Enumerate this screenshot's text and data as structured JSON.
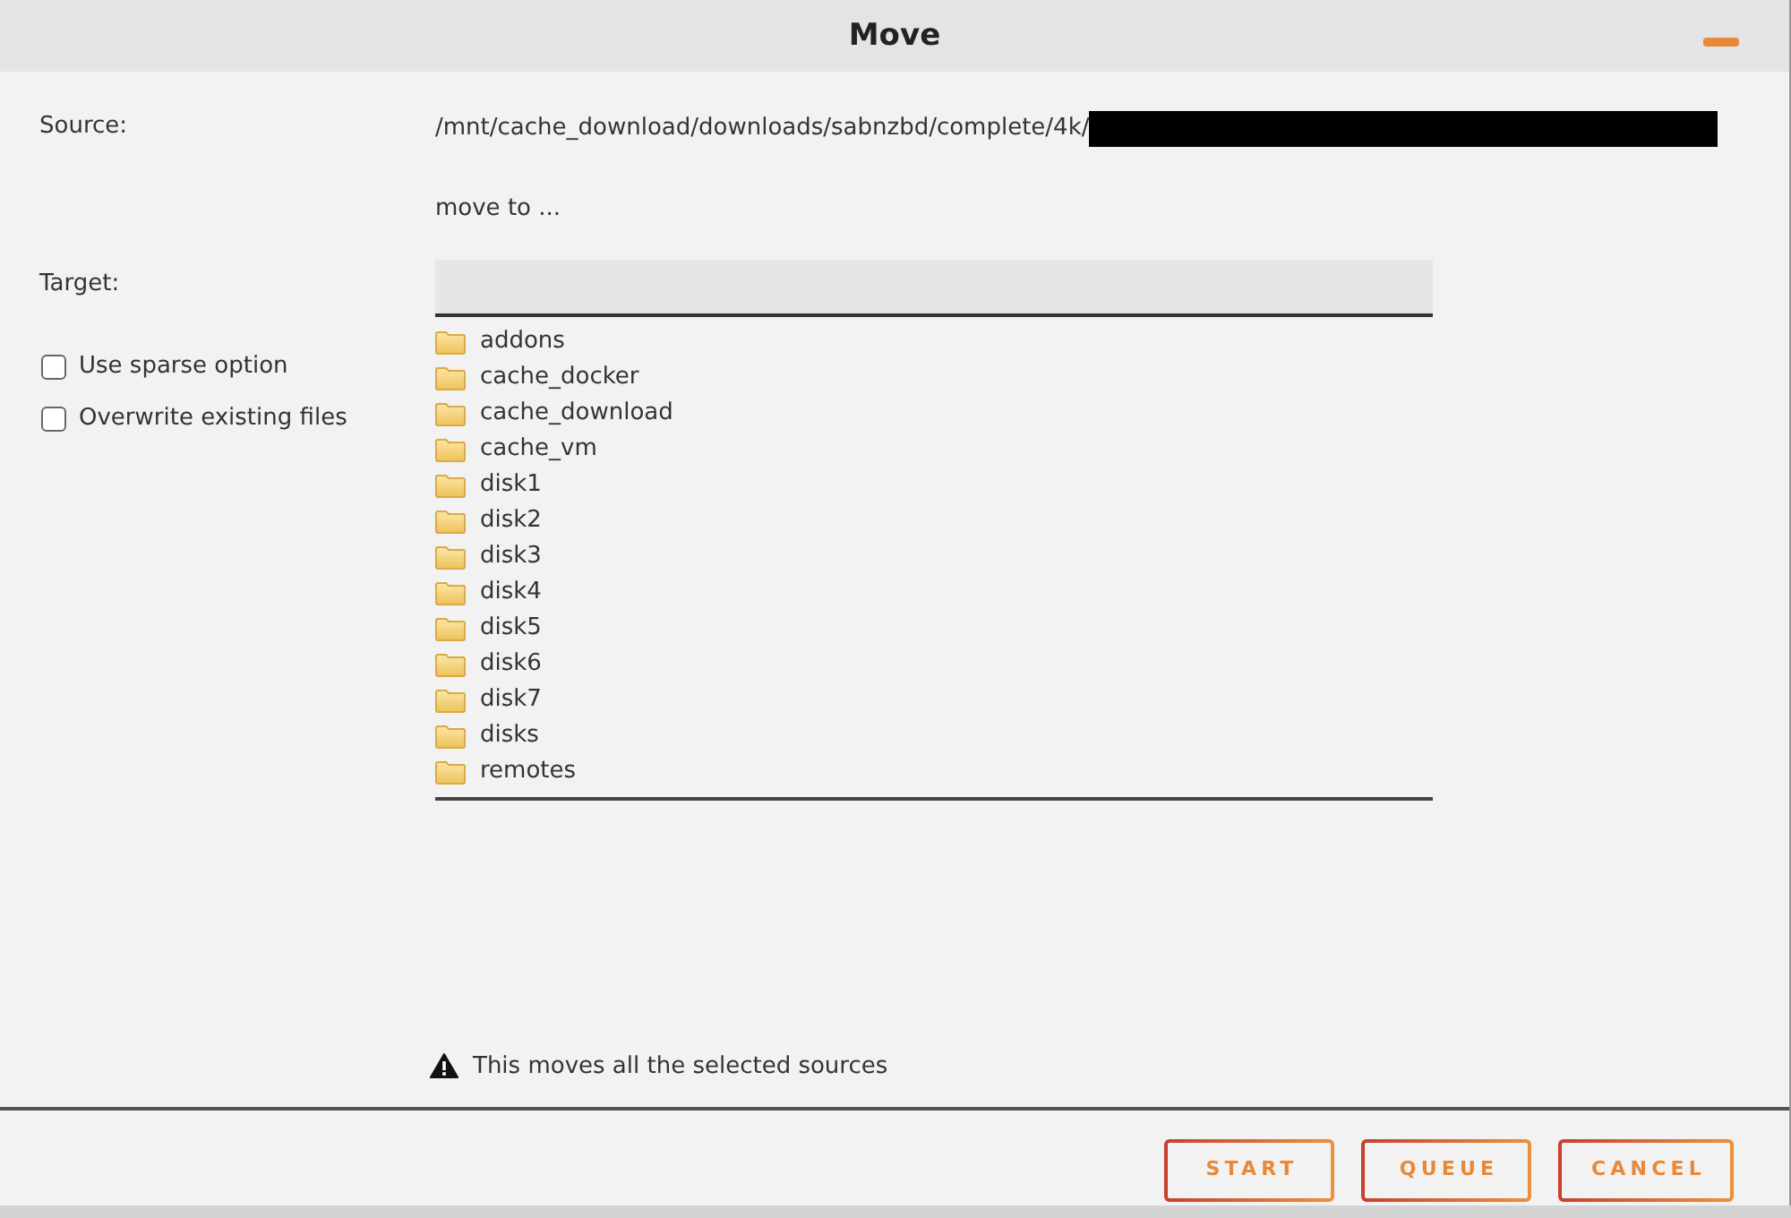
{
  "window": {
    "title": "Move"
  },
  "source": {
    "label": "Source:",
    "path": "/mnt/cache_download/downloads/sabnzbd/complete/4k/",
    "redacted": true
  },
  "move_to": "move to ...",
  "target": {
    "label": "Target:"
  },
  "options": [
    {
      "label": "Use sparse option",
      "checked": false
    },
    {
      "label": "Overwrite existing files",
      "checked": false
    }
  ],
  "folders": [
    "addons",
    "cache_docker",
    "cache_download",
    "cache_vm",
    "disk1",
    "disk2",
    "disk3",
    "disk4",
    "disk5",
    "disk6",
    "disk7",
    "disks",
    "remotes"
  ],
  "warning": "This moves all the selected sources",
  "buttons": [
    "START",
    "QUEUE",
    "CANCEL"
  ]
}
